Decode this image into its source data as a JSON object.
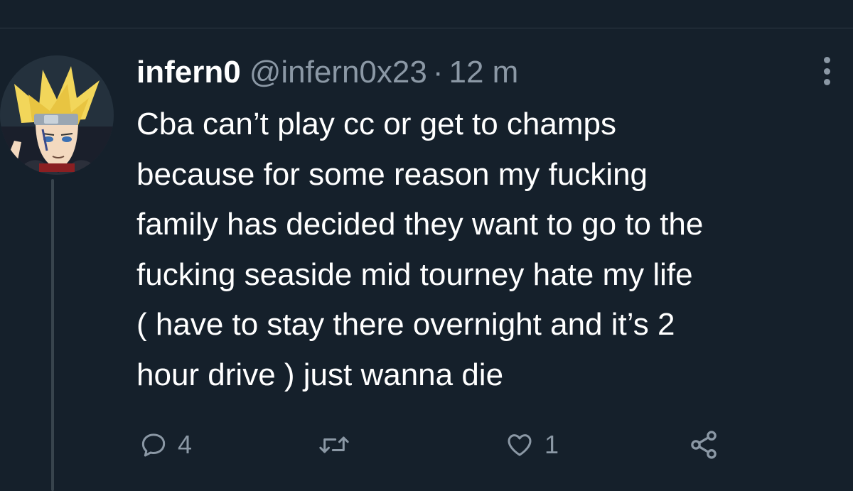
{
  "tweet": {
    "display_name": "infern0",
    "handle": "@infern0x23",
    "separator": "·",
    "time": "12 m",
    "text": "Cba can’t play cc or get to champs\nbecause for some reason my fucking\nfamily has decided they want to go to the\nfucking seaside mid tourney hate my life\n( have to stay there overnight and it’s 2\nhour drive ) just wanna die",
    "avatar_icon": "anime-character-avatar"
  },
  "actions": {
    "reply": {
      "icon": "reply-icon",
      "count": "4"
    },
    "retweet": {
      "icon": "retweet-icon",
      "count": ""
    },
    "like": {
      "icon": "heart-icon",
      "count": "1"
    },
    "share": {
      "icon": "share-icon"
    }
  },
  "colors": {
    "background": "#15202b",
    "text_primary": "#ffffff",
    "text_secondary": "#8b98a5",
    "divider": "#2f3a45"
  }
}
